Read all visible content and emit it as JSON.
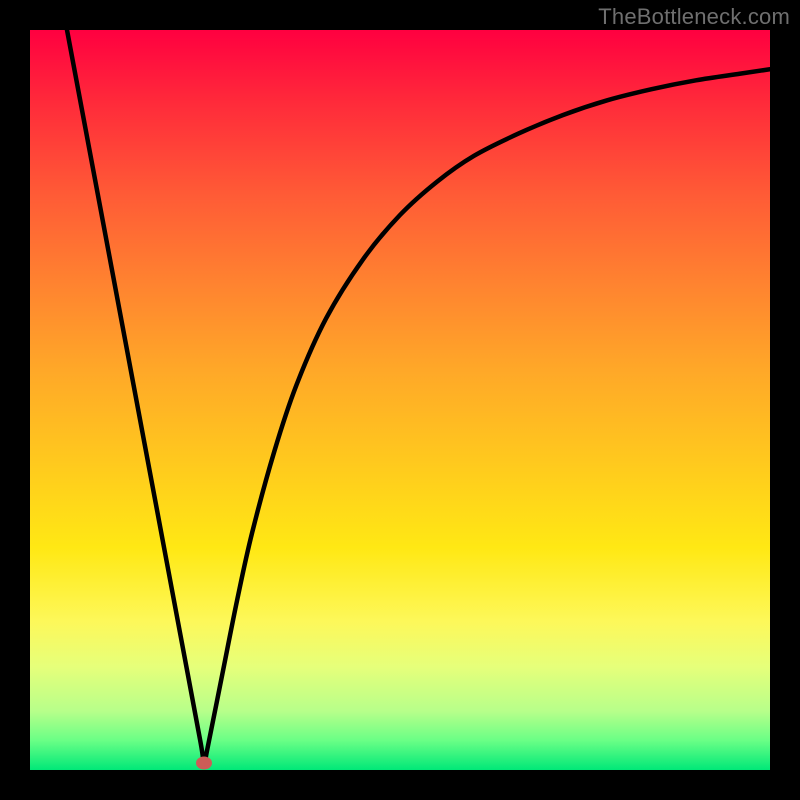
{
  "watermark": "TheBottleneck.com",
  "colors": {
    "curve": "#000000",
    "marker": "#cc5c57",
    "gradient_top": "#ff0040",
    "gradient_bottom": "#00e878",
    "frame": "#000000"
  },
  "chart_data": {
    "type": "line",
    "title": "",
    "xlabel": "",
    "ylabel": "",
    "xlim": [
      0,
      100
    ],
    "ylim": [
      0,
      100
    ],
    "grid": false,
    "legend": false,
    "annotations": [
      {
        "type": "marker",
        "x": 23.5,
        "y": 1.0,
        "color": "#cc5c57",
        "meaning": "minimum / sweet-spot"
      }
    ],
    "series": [
      {
        "name": "bottleneck-curve",
        "color": "#000000",
        "x": [
          5,
          8,
          11,
          14,
          17,
          20,
          23,
          23.5,
          24,
          26,
          28,
          30,
          33,
          36,
          40,
          45,
          50,
          55,
          60,
          66,
          72,
          78,
          84,
          90,
          96,
          100
        ],
        "y": [
          100,
          84,
          68,
          52,
          36,
          20,
          4,
          1.0,
          3,
          13,
          23,
          32,
          43,
          52,
          61,
          69,
          75,
          79.5,
          83,
          86,
          88.5,
          90.5,
          92,
          93.2,
          94.1,
          94.7
        ]
      }
    ]
  }
}
